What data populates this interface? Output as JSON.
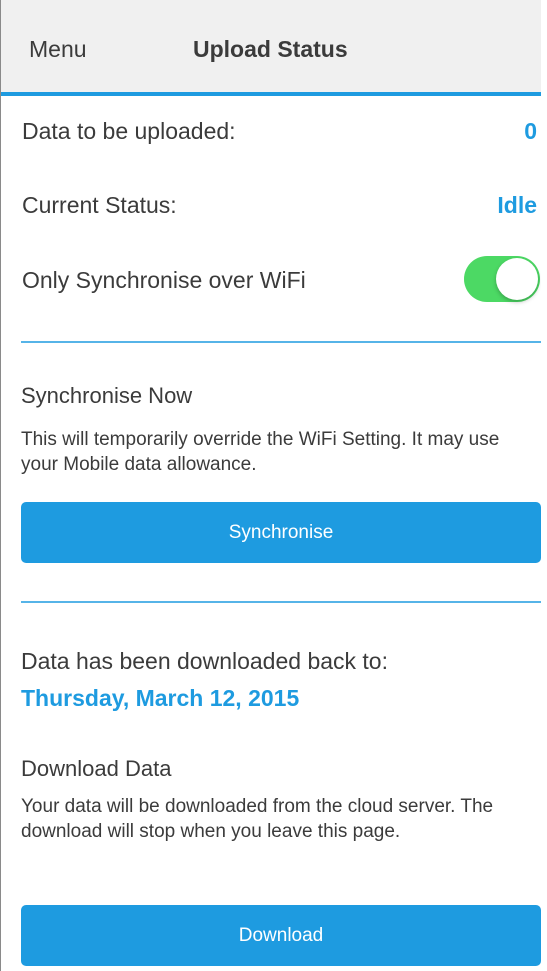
{
  "header": {
    "menu_label": "Menu",
    "title": "Upload Status"
  },
  "status": {
    "data_to_upload_label": "Data to be uploaded:",
    "data_to_upload_value": "0",
    "current_status_label": "Current Status:",
    "current_status_value": "Idle",
    "wifi_only_label": "Only Synchronise over WiFi",
    "wifi_only_enabled": true
  },
  "sync": {
    "title": "Synchronise Now",
    "description": "This will temporarily override the WiFi Setting.  It may use your Mobile data allowance.",
    "button_label": "Synchronise"
  },
  "download": {
    "downloaded_label": "Data has been downloaded back to:",
    "downloaded_date": "Thursday, March 12, 2015",
    "title": "Download Data",
    "description": "Your data will be downloaded from the cloud server. The download will stop when you leave this page.",
    "button_label": "Download"
  },
  "colors": {
    "accent": "#1e9be0",
    "toggle_on": "#4cd964",
    "header_bg": "#f0f0f0",
    "text": "#3b3b3b"
  }
}
